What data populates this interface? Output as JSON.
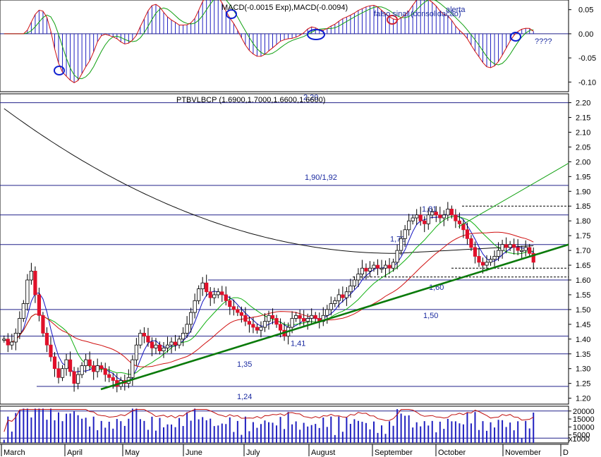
{
  "chart_data": {
    "type": "candlestick",
    "title": "PTBVLBCP (1.6900,1.7000,1.6600,1.6600)",
    "macd_title": "MACD(-0.0015 Exp),MACD(-0.0094)",
    "months": [
      "March",
      "April",
      "May",
      "June",
      "July",
      "August",
      "September",
      "October",
      "November",
      "D"
    ],
    "price_axis": {
      "ticks": [
        "2.20",
        "2.15",
        "2.10",
        "2.05",
        "2.00",
        "1.95",
        "1.90",
        "1.85",
        "1.80",
        "1.75",
        "1.70",
        "1.65",
        "1.60",
        "1.55",
        "1.50",
        "1.45",
        "1.40",
        "1.35",
        "1.30",
        "1.25",
        "1.20"
      ],
      "ylim": [
        1.18,
        2.23
      ]
    },
    "macd_axis": {
      "ticks": [
        "0.05",
        "0.00",
        "-0.05",
        "-0.10"
      ],
      "ylim": [
        -0.12,
        0.07
      ]
    },
    "volume_axis": {
      "ticks": [
        "20000",
        "15000",
        "10000",
        "5000"
      ],
      "unit": "x1000",
      "ylim": [
        0,
        23000
      ]
    },
    "support_lines": [
      {
        "value": 2.2,
        "label": "2,20"
      },
      {
        "value": 1.92,
        "label": "1,90/1,92"
      },
      {
        "value": 1.82,
        "label": "1,81"
      },
      {
        "value": 1.72,
        "label": "1,72"
      },
      {
        "value": 1.6,
        "label": "1,60"
      },
      {
        "value": 1.5,
        "label": "1,50"
      },
      {
        "value": 1.41,
        "label": "1,41"
      },
      {
        "value": 1.35,
        "label": "1,35"
      },
      {
        "value": 1.24,
        "label": "1,24"
      }
    ],
    "annotations": {
      "false_signal": "falso sinal (consolidação)",
      "alert": "alerta",
      "question": "????"
    },
    "close_series": [
      1.4,
      1.38,
      1.39,
      1.42,
      1.47,
      1.52,
      1.6,
      1.63,
      1.55,
      1.48,
      1.42,
      1.38,
      1.34,
      1.3,
      1.27,
      1.3,
      1.33,
      1.29,
      1.25,
      1.28,
      1.31,
      1.33,
      1.31,
      1.29,
      1.31,
      1.3,
      1.28,
      1.27,
      1.26,
      1.24,
      1.26,
      1.25,
      1.27,
      1.33,
      1.38,
      1.42,
      1.41,
      1.39,
      1.37,
      1.38,
      1.36,
      1.37,
      1.38,
      1.39,
      1.38,
      1.4,
      1.42,
      1.45,
      1.49,
      1.53,
      1.57,
      1.59,
      1.56,
      1.54,
      1.55,
      1.56,
      1.55,
      1.53,
      1.51,
      1.5,
      1.49,
      1.48,
      1.46,
      1.45,
      1.44,
      1.43,
      1.44,
      1.46,
      1.48,
      1.47,
      1.45,
      1.43,
      1.41,
      1.44,
      1.47,
      1.48,
      1.47,
      1.46,
      1.47,
      1.48,
      1.47,
      1.46,
      1.48,
      1.5,
      1.52,
      1.53,
      1.55,
      1.54,
      1.56,
      1.58,
      1.6,
      1.62,
      1.64,
      1.63,
      1.64,
      1.65,
      1.64,
      1.64,
      1.65,
      1.64,
      1.66,
      1.7,
      1.74,
      1.77,
      1.8,
      1.81,
      1.82,
      1.8,
      1.79,
      1.82,
      1.83,
      1.82,
      1.81,
      1.82,
      1.84,
      1.82,
      1.8,
      1.79,
      1.77,
      1.74,
      1.71,
      1.68,
      1.66,
      1.65,
      1.66,
      1.67,
      1.68,
      1.7,
      1.72,
      1.71,
      1.72,
      1.71,
      1.7,
      1.7,
      1.71,
      1.69,
      1.66
    ]
  }
}
